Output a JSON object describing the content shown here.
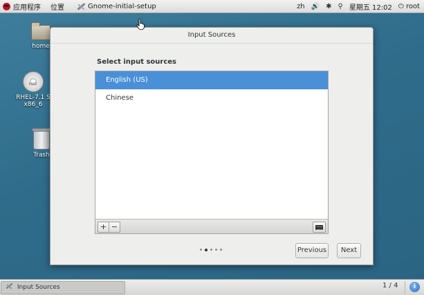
{
  "top_panel": {
    "applications": "应用程序",
    "places": "位置",
    "active_app": "Gnome-initial-setup",
    "input_method": "zh",
    "volume_icon": "🔊",
    "bluetooth_icon": "✱",
    "network_icon": "⚲",
    "datetime": "星期五 12:02",
    "user": "root"
  },
  "desktop": {
    "icons": [
      {
        "label": "home",
        "icon": "folder-icon"
      },
      {
        "label": "RHEL-7.1 S",
        "label2": "x86_6",
        "icon": "disc-icon"
      },
      {
        "label": "Trash",
        "icon": "trash-icon"
      }
    ]
  },
  "dialog": {
    "title": "Input Sources",
    "section_label": "Select input sources",
    "sources": [
      "English (US)",
      "Chinese"
    ],
    "selected_index": 0,
    "add_label": "+",
    "remove_label": "−",
    "page_count": 5,
    "current_page": 2,
    "previous_label": "Previous",
    "next_label": "Next",
    "colors": {
      "selection": "#4a90d9"
    }
  },
  "bottom_panel": {
    "task_label": "Input Sources",
    "workspace": "1 / 4",
    "info_glyph": "i"
  }
}
